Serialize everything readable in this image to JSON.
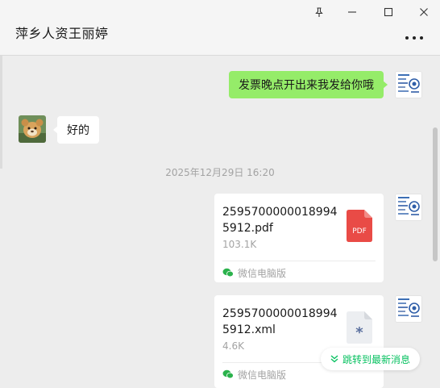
{
  "window": {
    "pin_icon": "pin-icon",
    "minimize_icon": "minimize-icon",
    "maximize_icon": "maximize-icon",
    "close_icon": "close-icon"
  },
  "header": {
    "title": "萍乡人资王丽婷",
    "more_icon": "more-icon"
  },
  "messages": {
    "outgoing_text": "发票晚点开出来我发给你哦",
    "incoming_text": "好的",
    "timestamp": "2025年12月29日 16:20",
    "files": [
      {
        "name": "25957000000189945912.pdf",
        "size": "103.1K",
        "type_label": "PDF",
        "source": "微信电脑版"
      },
      {
        "name": "25957000000189945912.xml",
        "size": "4.6K",
        "type_label": "*",
        "source": "微信电脑版"
      }
    ]
  },
  "jump_to_latest": "跳转到最新消息",
  "colors": {
    "outgoing_bubble": "#95ec69",
    "pdf_icon": "#e94b46",
    "accent_green": "#07c160"
  }
}
